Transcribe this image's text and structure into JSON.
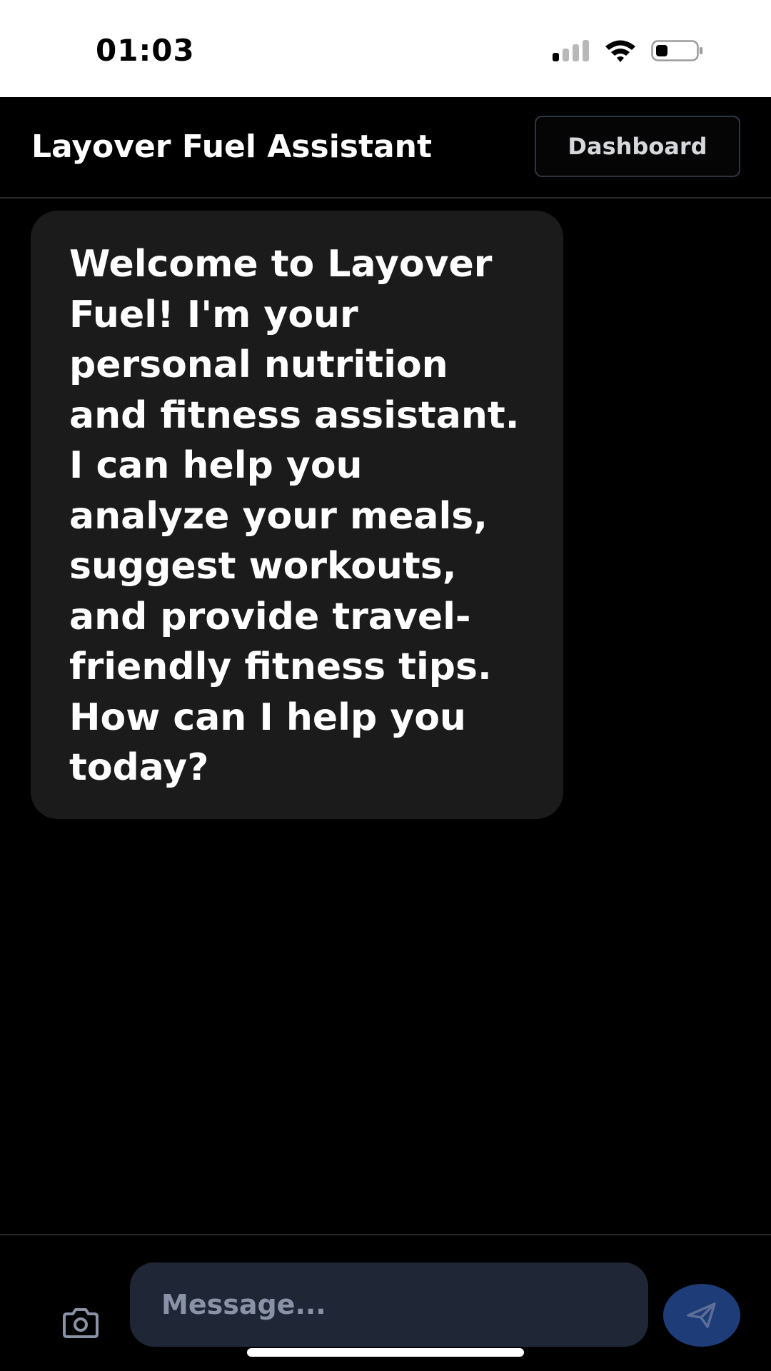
{
  "status_bar": {
    "time": "01:03",
    "icons": [
      "cellular-signal-icon",
      "wifi-icon",
      "battery-icon"
    ]
  },
  "header": {
    "title": "Layover Fuel Assistant",
    "dashboard_label": "Dashboard"
  },
  "chat": {
    "messages": [
      {
        "sender": "assistant",
        "text": "Welcome to Layover Fuel! I'm your personal nutrition and fitness assistant. I can help you analyze your meals, suggest workouts, and provide travel-friendly fitness tips. How can I help you today?"
      }
    ]
  },
  "composer": {
    "placeholder": "Message...",
    "value": "",
    "camera_icon": "camera-icon",
    "send_icon": "send-icon"
  },
  "colors": {
    "background": "#000000",
    "bubble": "#1b1b1b",
    "input": "#1f2737",
    "send_button": "#1e3c78",
    "status_bar": "#ffffff"
  }
}
